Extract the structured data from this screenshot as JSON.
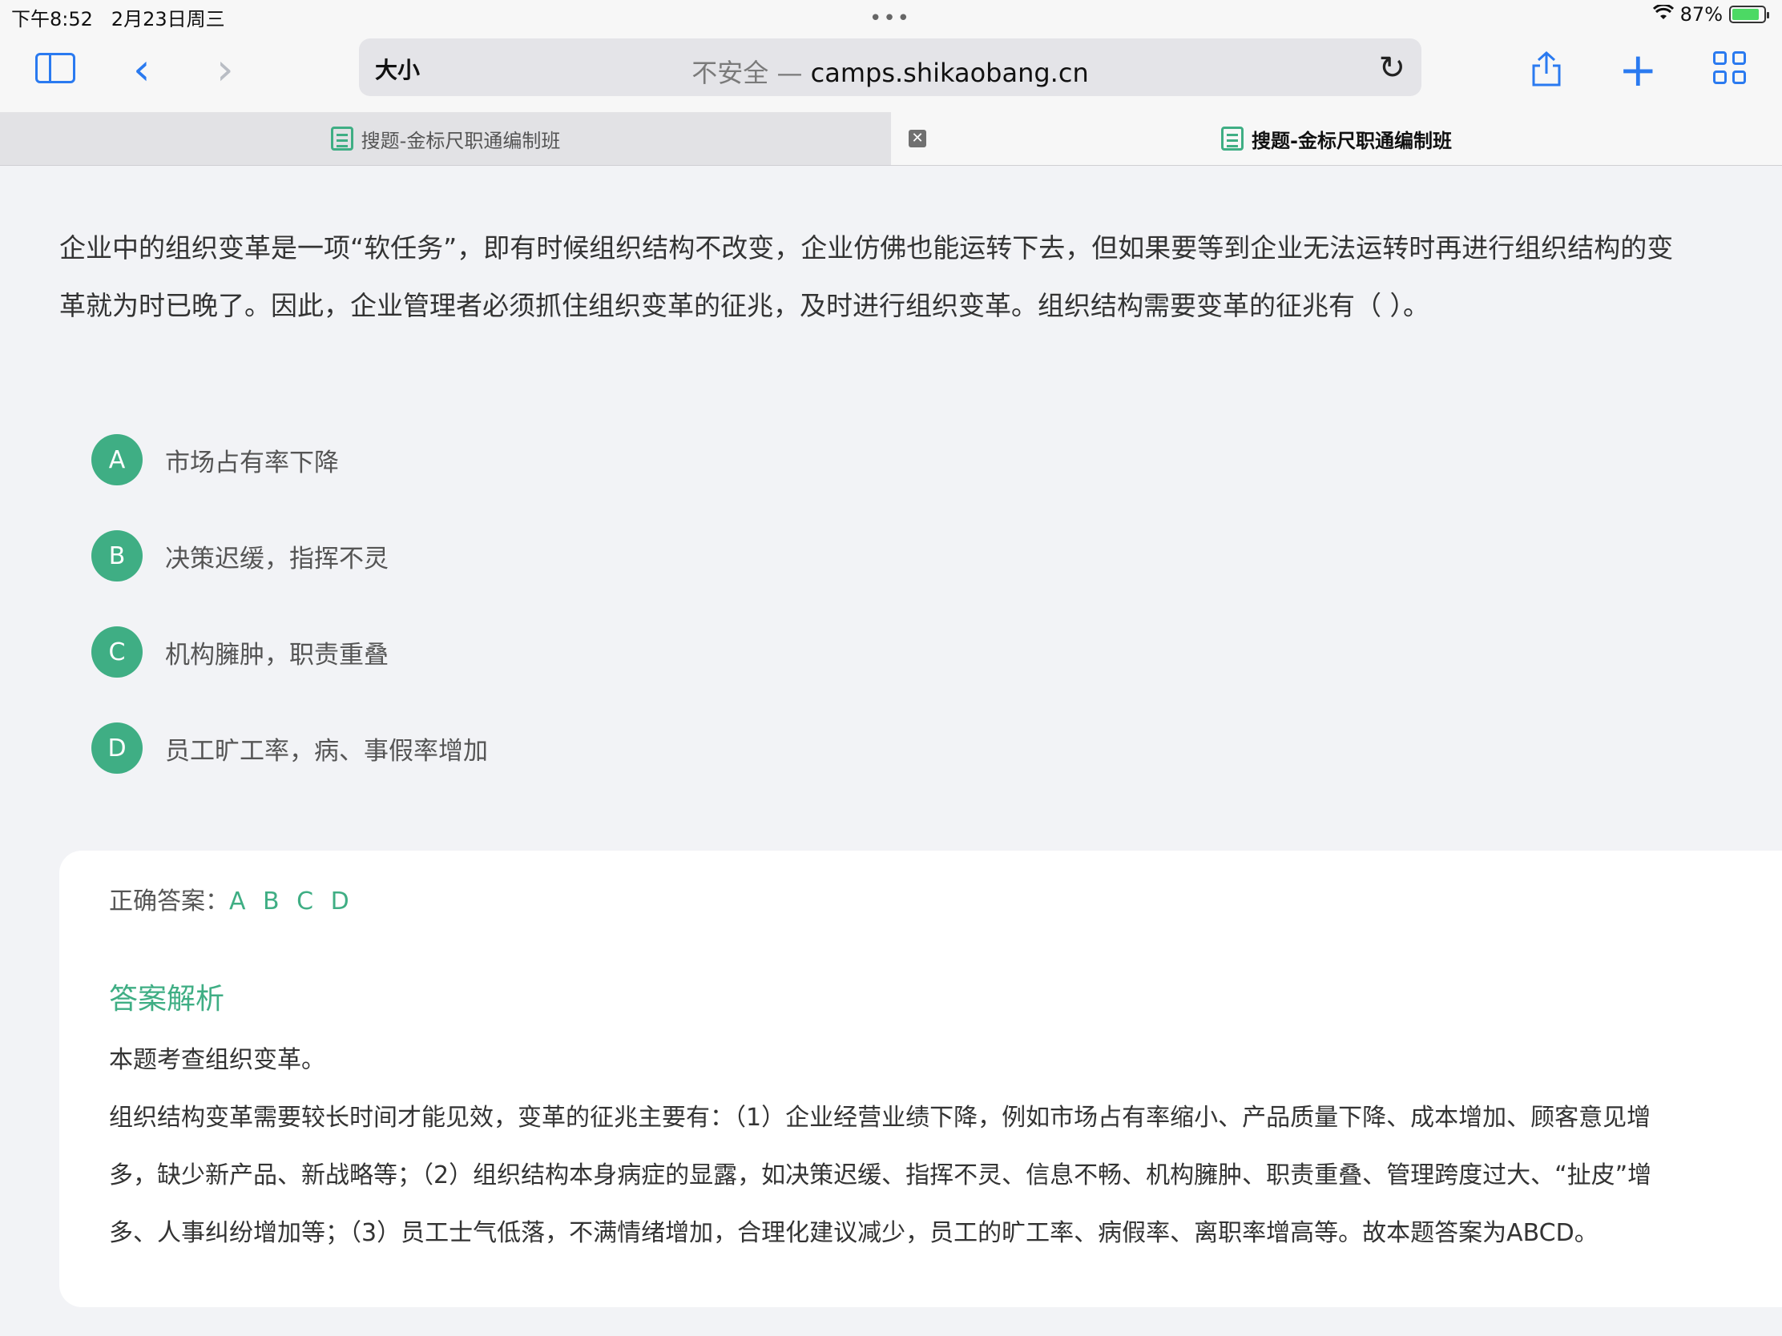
{
  "status": {
    "time": "下午8:52",
    "date": "2月23日周三",
    "battery": "87%",
    "battery_level": 0.87
  },
  "toolbar": {
    "text_size": "大小",
    "url_insecure": "不安全 —",
    "url_domain": "camps.shikaobang.cn"
  },
  "tabs": [
    {
      "title": "搜题-金标尺职通编制班"
    },
    {
      "title": "搜题-金标尺职通编制班"
    }
  ],
  "question": {
    "line1": "企业中的组织变革是一项“软任务”，即有时候组织结构不改变，企业仿佛也能运转下去，但如果要等到企业无法运转时再进行组织结构的变",
    "line2": "革就为时已晚了。因此，企业管理者必须抓住组织变革的征兆，及时进行组织变革。组织结构需要变革的征兆有（ ）。"
  },
  "options": [
    {
      "letter": "A",
      "text": "市场占有率下降"
    },
    {
      "letter": "B",
      "text": "决策迟缓，指挥不灵"
    },
    {
      "letter": "C",
      "text": "机构臃肿，职责重叠"
    },
    {
      "letter": "D",
      "text": "员工旷工率，病、事假率增加"
    }
  ],
  "answer": {
    "label": "正确答案：",
    "value": "A B C D",
    "analysis_title": "答案解析",
    "p1": "本题考查组织变革。",
    "p2_line1": "组织结构变革需要较长时间才能见效，变革的征兆主要有：（1）企业经营业绩下降，例如市场占有率缩小、产品质量下降、成本增加、顾客意见增",
    "p2_line2": "多，缺少新产品、新战略等；（2）组织结构本身病症的显露，如决策迟缓、指挥不灵、信息不畅、机构臃肿、职责重叠、管理跨度过大、“扯皮”增",
    "p2_line3": "多、人事纠纷增加等；（3）员工士气低落，不满情绪增加，合理化建议减少，员工的旷工率、病假率、离职率增高等。故本题答案为ABCD。"
  },
  "colors": {
    "accent": "#3fae84",
    "link": "#2a7af0"
  }
}
